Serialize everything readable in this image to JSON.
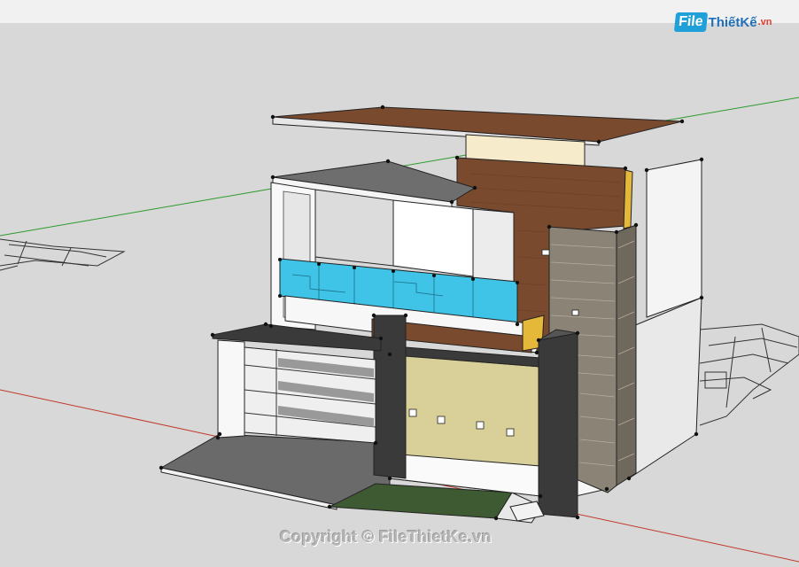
{
  "watermark": {
    "logo_file": "File",
    "logo_name": "ThiếtKế",
    "logo_tld": ".vn",
    "copyright": "Copyright © FileThietKe.vn"
  },
  "colors": {
    "background": "#d8d8d8",
    "axis_green": "#2d9a2d",
    "axis_red": "#c0392b",
    "wood": "#7a4a2e",
    "glass": "#3fc3e6",
    "stone": "#8a8376",
    "wall_panel": "#d9cf98",
    "lawn": "#3d5a32",
    "dark_steel": "#3a3a3a"
  },
  "icons": {
    "logo": "filethietke-logo"
  }
}
